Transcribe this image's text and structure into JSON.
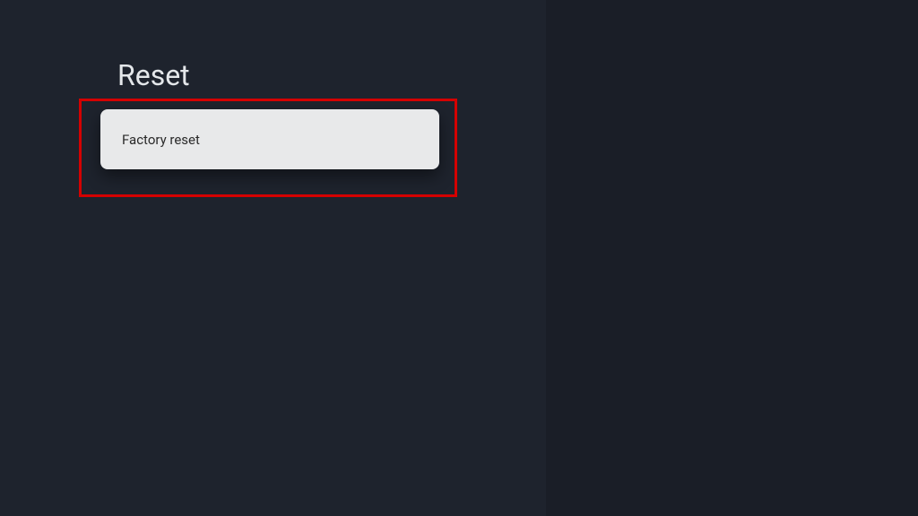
{
  "page": {
    "title": "Reset"
  },
  "options": [
    {
      "label": "Factory reset"
    }
  ],
  "colors": {
    "bg_left": "#1e232d",
    "bg_right": "#1a1e27",
    "title_text": "#e4e7ea",
    "item_bg": "#e8e9ea",
    "item_text": "#2a2a2a",
    "highlight_border": "#d40000"
  }
}
